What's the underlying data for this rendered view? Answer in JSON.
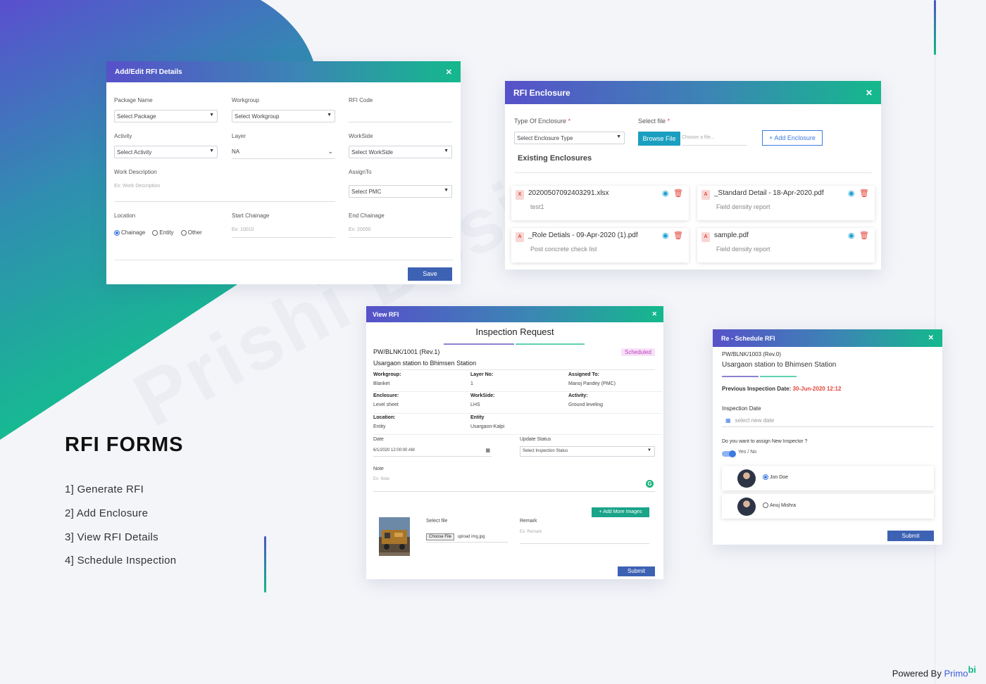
{
  "page": {
    "title": "RFI FORMS",
    "menu": [
      "1] Generate RFI",
      "2] Add Enclosure",
      "3] View RFI Details",
      "4] Schedule Inspection"
    ],
    "watermark": "Prishi Designer",
    "powered_by": "Powered By",
    "brand": "Primo",
    "brand_suffix": "bi"
  },
  "colors": {
    "accent": "#3d62b4",
    "gradient_start": "#5751c9",
    "gradient_end": "#14b98c",
    "danger": "#e4453a",
    "badge": "#c03ec0"
  },
  "add_edit": {
    "title": "Add/Edit RFI Details",
    "close": "✕",
    "package_label": "Package Name",
    "package_value": "Select Package",
    "workgroup_label": "Workgroup",
    "workgroup_value": "Select Workgroup",
    "rfi_code_label": "RFI Code",
    "activity_label": "Activity",
    "activity_value": "Select Activity",
    "layer_label": "Layer",
    "layer_value": "NA",
    "workside_label": "WorkSide",
    "workside_value": "Select WorkSide",
    "work_desc_label": "Work Description",
    "work_desc_placeholder": "Ex: Work Description",
    "assignto_label": "AssignTo",
    "assignto_value": "Select PMC",
    "location_label": "Location",
    "location_options": [
      "Chainage",
      "Entity",
      "Other"
    ],
    "start_label": "Start Chainage",
    "start_placeholder": "Ex: 10010",
    "end_label": "End Chainage",
    "end_placeholder": "Ex: 20050",
    "save": "Save"
  },
  "enclosure": {
    "title": "RFI Enclosure",
    "close": "✕",
    "type_label": "Type Of Enclosure",
    "required": "*",
    "type_value": "Select Enclosure Type",
    "file_label": "Select file",
    "browse": "Browse File",
    "file_placeholder": "Choose a file...",
    "add": "Add Enclosure",
    "existing": "Existing Enclosures",
    "files": [
      {
        "name": "20200507092403291.xlsx",
        "desc": "test1"
      },
      {
        "name": "_Standard Detail - 18-Apr-2020.pdf",
        "desc": "Field density report"
      },
      {
        "name": "_Role Detials - 09-Apr-2020 (1).pdf",
        "desc": "Post concrete check list"
      },
      {
        "name": "sample.pdf",
        "desc": "Field density report"
      }
    ]
  },
  "view_rfi": {
    "title": "View RFI",
    "close": "✕",
    "heading": "Inspection Request",
    "code": "PW/BLNK/1001 (Rev.1)",
    "status": "Scheduled",
    "route": "Usargaon station to Bhimsen Station",
    "fields": [
      {
        "label": "Workgroup:",
        "value": "Blanket"
      },
      {
        "label": "Layer No:",
        "value": "1"
      },
      {
        "label": "Assigned To:",
        "value": "Manoj Pandey (PMC)"
      },
      {
        "label": "Enclosure:",
        "value": "Level sheet"
      },
      {
        "label": "WorkSide:",
        "value": "LHS"
      },
      {
        "label": "Activity:",
        "value": "Ground leveling"
      },
      {
        "label": "Location:",
        "value": "Entity"
      },
      {
        "label": "Entity",
        "value": "Usargaon-Kalpi"
      }
    ],
    "date_label": "Date",
    "date_value": "6/1/2020 12:00:00 AM",
    "update_label": "Update Status",
    "update_value": "Select Inspection Status",
    "note_label": "Note",
    "note_placeholder": "Ex: Note",
    "add_images": "Add More Images",
    "select_file": "Select file",
    "choose": "Choose File",
    "file_name": "upload img.jpg",
    "remark_label": "Remark",
    "remark_placeholder": "Ex: Remark",
    "submit": "Submit"
  },
  "reschedule": {
    "title": "Re - Schedule RFI",
    "close": "✕",
    "code": "PW/BLNK/1003 (Rev.0)",
    "route": "Usargaon station to Bhimsen Station",
    "prev_label": "Previous Inspection Date:",
    "prev_value": "30-Jun-2020 12:12",
    "date_label": "Inspection Date",
    "date_placeholder": "select new date",
    "question": "Do you want to assign New Inspector ?",
    "toggle_label": "Yes / No",
    "inspectors": [
      {
        "name": "Jon Doe",
        "selected": true
      },
      {
        "name": "Anuj Mishra",
        "selected": false
      }
    ],
    "submit": "Submit"
  }
}
